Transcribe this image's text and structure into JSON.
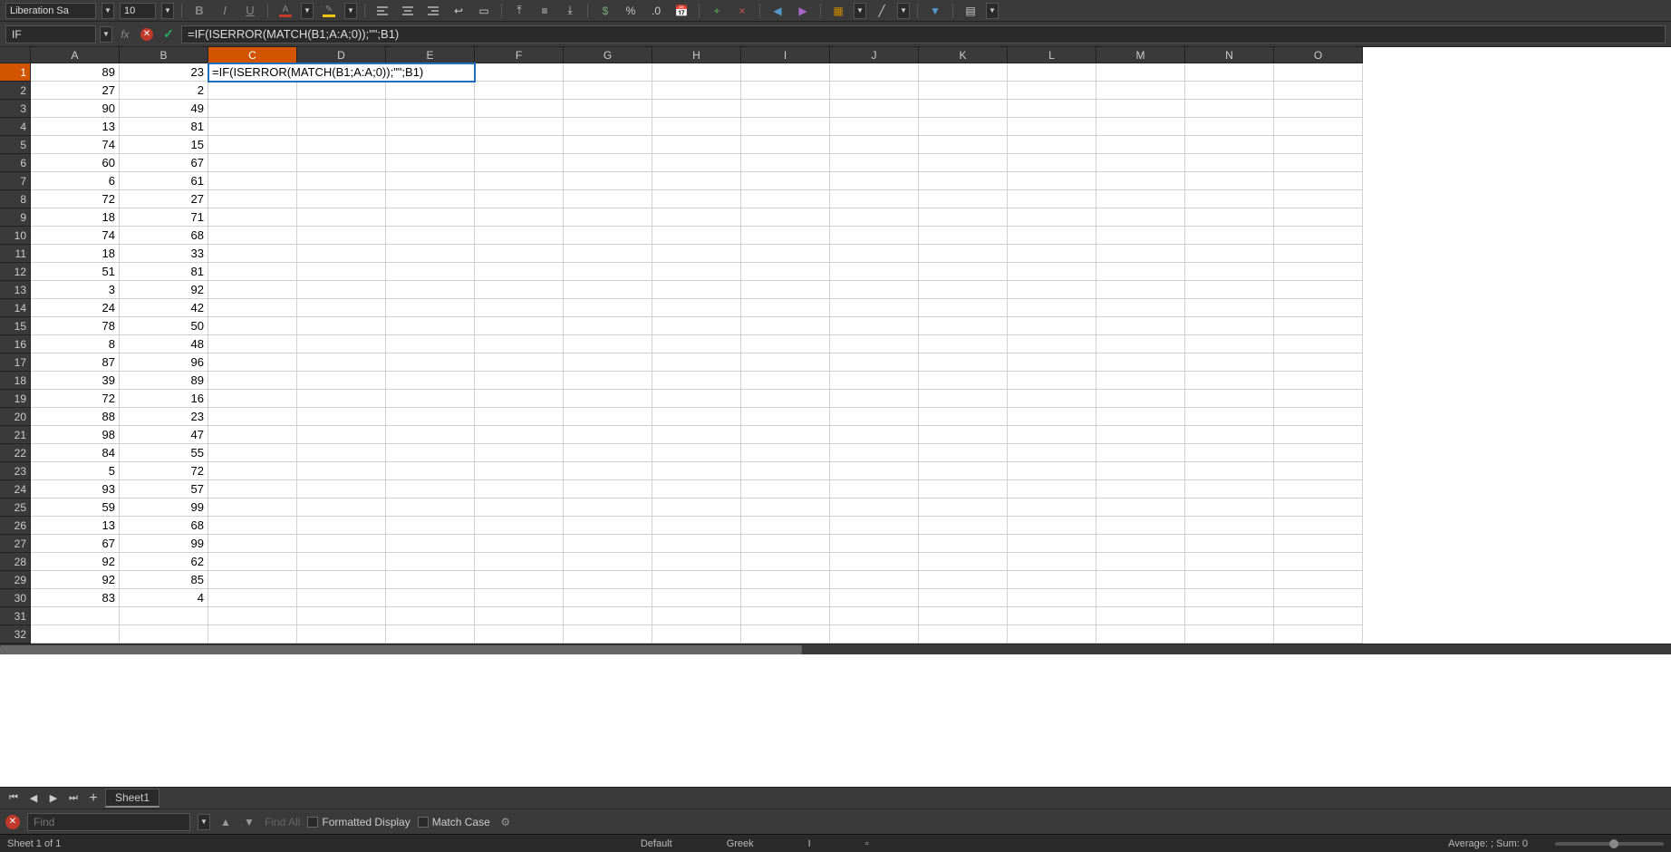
{
  "toolbar": {
    "font_name": "Liberation Sa",
    "font_size": "10"
  },
  "formula_bar": {
    "name_box": "IF",
    "formula": "=IF(ISERROR(MATCH(B1;A:A;0));\"\";B1)"
  },
  "columns": [
    "A",
    "B",
    "C",
    "D",
    "E",
    "F",
    "G",
    "H",
    "I",
    "J",
    "K",
    "L",
    "M",
    "N",
    "O"
  ],
  "row_count": 32,
  "active_col_index": 2,
  "active_row_index": 0,
  "editing_cell_text": "=IF(ISERROR(MATCH(B1;A:A;0));\"\";B1)",
  "data_a": [
    "89",
    "27",
    "90",
    "13",
    "74",
    "60",
    "6",
    "72",
    "18",
    "74",
    "18",
    "51",
    "3",
    "24",
    "78",
    "8",
    "87",
    "39",
    "72",
    "88",
    "98",
    "84",
    "5",
    "93",
    "59",
    "13",
    "67",
    "92",
    "92",
    "83"
  ],
  "data_b": [
    "23",
    "2",
    "49",
    "81",
    "15",
    "67",
    "61",
    "27",
    "71",
    "68",
    "33",
    "81",
    "92",
    "42",
    "50",
    "48",
    "96",
    "89",
    "16",
    "23",
    "47",
    "55",
    "72",
    "57",
    "99",
    "68",
    "99",
    "62",
    "85",
    "4"
  ],
  "sheet_tabs": {
    "active": "Sheet1"
  },
  "find": {
    "placeholder": "Find",
    "find_all": "Find All",
    "formatted": "Formatted Display",
    "match_case": "Match Case"
  },
  "status": {
    "sheet_info": "Sheet 1 of 1",
    "style": "Default",
    "lang": "Greek",
    "summary": "Average: ; Sum: 0"
  }
}
